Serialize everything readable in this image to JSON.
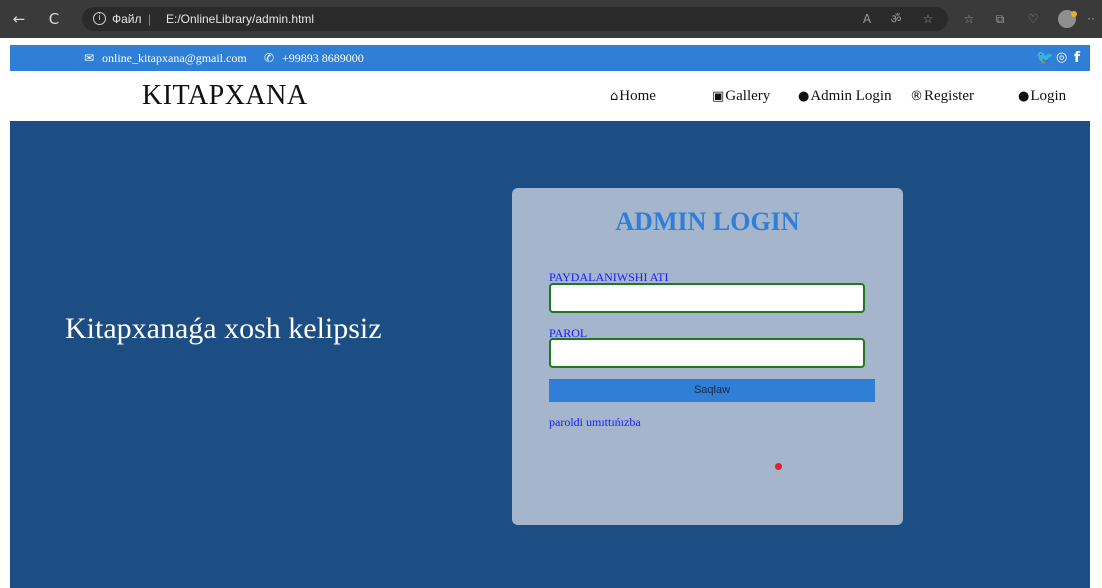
{
  "browser": {
    "back_icon": "←",
    "reload_icon": "C",
    "info_icon": "i",
    "scheme": "Файл",
    "separator": "|",
    "url": "E:/OnlineLibrary/admin.html",
    "read_aloud_icon": "A",
    "translate_icon": "ॐ",
    "favorite_icon": "☆",
    "favorites_icon": "☆",
    "collections_icon": "⧉",
    "extensions_icon": "♡",
    "more_icon": "··"
  },
  "topbar": {
    "email_icon": "✉",
    "email": "online_kitapxana@gmail.com",
    "phone_icon": "✆",
    "phone": "+99893 8689000",
    "twitter_icon": "🐦",
    "instagram_icon": "◎",
    "facebook_icon": "f",
    "bg_color": "#2f7fd6"
  },
  "navbar": {
    "brand": "KITAPXANA",
    "items": [
      {
        "icon": "⌂",
        "label": "Home"
      },
      {
        "icon": "▣",
        "label": "Gallery"
      },
      {
        "icon": "●",
        "label": "Admin Login"
      },
      {
        "icon": "®",
        "label": "Register"
      },
      {
        "icon": "●",
        "label": "Login"
      }
    ]
  },
  "hero": {
    "welcome": "Kitapxanaǵa xosh kelipsiz",
    "bg_color": "#1d4e83"
  },
  "login_form": {
    "title": "ADMIN LOGIN",
    "username_label": "PAYDALANIWSHI ATI",
    "username_value": "",
    "password_label": "PAROL",
    "password_value": "",
    "submit_label": "Saqlaw",
    "forgot_link": "paroldi umıttıńızba"
  }
}
